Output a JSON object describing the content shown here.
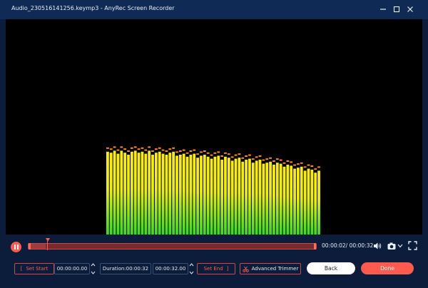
{
  "window": {
    "title": "Audio_230516141256.keymp3 - AnyRec Screen Recorder"
  },
  "window_controls": {
    "minimize_icon": "minimize-icon",
    "maximize_icon": "maximize-icon",
    "close_icon": "close-icon"
  },
  "player": {
    "pause_icon": "pause-icon",
    "progress_fraction": 0.06,
    "time_display": "00:00:02/ 00:00:32",
    "volume_icon": "volume-icon",
    "snapshot_icon": "camera-icon",
    "fullscreen_icon": "fullscreen-icon"
  },
  "visualizer": {
    "bar_levels": [
      0.83,
      0.82,
      0.84,
      0.81,
      0.84,
      0.82,
      0.8,
      0.83,
      0.84,
      0.82,
      0.83,
      0.81,
      0.84,
      0.8,
      0.82,
      0.83,
      0.81,
      0.8,
      0.82,
      0.83,
      0.79,
      0.8,
      0.81,
      0.78,
      0.8,
      0.81,
      0.77,
      0.79,
      0.8,
      0.78,
      0.76,
      0.78,
      0.79,
      0.75,
      0.78,
      0.77,
      0.74,
      0.76,
      0.77,
      0.73,
      0.75,
      0.76,
      0.72,
      0.74,
      0.75,
      0.71,
      0.72,
      0.73,
      0.7,
      0.72,
      0.71,
      0.68,
      0.7,
      0.69,
      0.66,
      0.67,
      0.68,
      0.64,
      0.66,
      0.65,
      0.62,
      0.64
    ]
  },
  "trim": {
    "set_start_label": "Set Start",
    "start_time": "00:00:00.00",
    "duration_label": "Duration:00:00:32",
    "end_time": "00:00:32.00",
    "set_end_label": "Set End",
    "advanced_trimmer_label": "Advanced Trimmer",
    "advanced_icon": "scissors-icon"
  },
  "actions": {
    "back_label": "Back",
    "done_label": "Done"
  },
  "colors": {
    "accent": "#ff5a4e",
    "background": "#0b1d3a",
    "bar_top": "#ffee00",
    "bar_bottom": "#33dd22",
    "peak": "#ff8a1e"
  }
}
